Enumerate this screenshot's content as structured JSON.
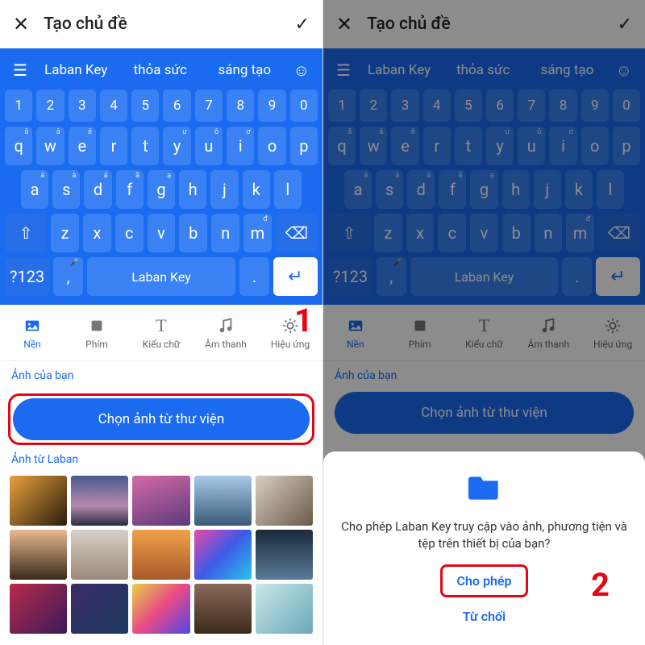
{
  "title": "Tạo chủ đề",
  "suggestions": [
    "Laban Key",
    "thỏa sức",
    "sáng tạo"
  ],
  "numRow": [
    "1",
    "2",
    "3",
    "4",
    "5",
    "6",
    "7",
    "8",
    "9",
    "0"
  ],
  "r1": [
    "q",
    "w",
    "e",
    "r",
    "t",
    "y",
    "u",
    "i",
    "o",
    "p"
  ],
  "sup1": [
    "ă",
    "â",
    "ê",
    "",
    "",
    "ư",
    "ô",
    "ơ",
    "",
    ""
  ],
  "r2": [
    "a",
    "s",
    "d",
    "f",
    "g",
    "h",
    "j",
    "k",
    "l"
  ],
  "sup2": [
    "á",
    "à",
    "ả",
    "ã",
    "ạ",
    "",
    "",
    "",
    ""
  ],
  "r3": [
    "z",
    "x",
    "c",
    "v",
    "b",
    "n",
    "m"
  ],
  "sup3": [
    "",
    "",
    "",
    "",
    "",
    "",
    "đ"
  ],
  "symKey": "?123",
  "spaceLabel": "Laban Key",
  "tabs": [
    {
      "icon": "image",
      "label": "Nền",
      "active": true
    },
    {
      "icon": "square",
      "label": "Phím"
    },
    {
      "icon": "T",
      "label": "Kiểu chữ"
    },
    {
      "icon": "note",
      "label": "Âm thanh"
    },
    {
      "icon": "sun",
      "label": "Hiệu ứng"
    }
  ],
  "section1": "Ảnh của bạn",
  "chooseBtn": "Chọn ảnh từ thư viện",
  "section2": "Ảnh từ Laban",
  "step1": "1",
  "step2": "2",
  "thumbs": [
    "linear-gradient(135deg,#e8a23c 0%,#2b1a0e 100%)",
    "linear-gradient(180deg,#4a5a8c 0%,#b78ab0 60%,#2a2a40 100%)",
    "linear-gradient(160deg,#d66aa8 0%,#5a3a7a 100%)",
    "linear-gradient(180deg,#a8c8e8 0%,#3a5a7a 100%)",
    "linear-gradient(135deg,#d8cfc0 0%,#6a5a4a 100%)",
    "linear-gradient(180deg,#e8b890 0%,#3a2a1a 100%)",
    "linear-gradient(180deg,#d8d0c8 0%,#9a8a7a 100%)",
    "linear-gradient(180deg,#f0a048 0%,#a85a2a 100%)",
    "linear-gradient(135deg,#e84aa8 0%,#3a5ae8 50%,#28c8e8 100%)",
    "linear-gradient(180deg,#1a2a3a 0%,#5a7a9a 100%)",
    "linear-gradient(135deg,#b82a4a 0%,#3a1a5a 100%)",
    "linear-gradient(135deg,#3a2a6a 0%,#1a3a5a 100%)",
    "linear-gradient(135deg,#e8d048 0%,#e84a88 50%,#4a48e8 100%)",
    "linear-gradient(180deg,#8a6a5a 0%,#3a2a1a 100%)",
    "linear-gradient(135deg,#c8e8e8 0%,#6aa8b8 100%)"
  ],
  "dialog": {
    "msg": "Cho phép Laban Key truy cập vào ảnh, phương tiện và tệp trên thiết bị của bạn?",
    "allow": "Cho phép",
    "deny": "Từ chối"
  }
}
